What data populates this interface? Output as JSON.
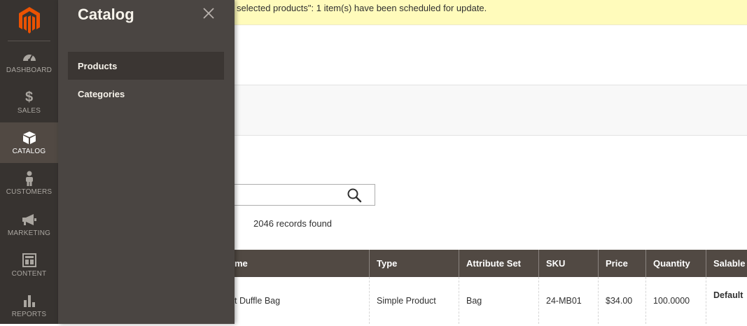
{
  "notice": {
    "text": "selected products\": 1 item(s) have been scheduled for update."
  },
  "nav": {
    "items": [
      {
        "label": "DASHBOARD",
        "icon": "dashboard-icon"
      },
      {
        "label": "SALES",
        "icon": "dollar-icon"
      },
      {
        "label": "CATALOG",
        "icon": "box-icon",
        "active": true
      },
      {
        "label": "CUSTOMERS",
        "icon": "person-icon"
      },
      {
        "label": "MARKETING",
        "icon": "megaphone-icon"
      },
      {
        "label": "CONTENT",
        "icon": "layout-icon"
      },
      {
        "label": "REPORTS",
        "icon": "bar-chart-icon"
      }
    ]
  },
  "submenu": {
    "title": "Catalog",
    "items": [
      {
        "label": "Products",
        "active": true
      },
      {
        "label": "Categories"
      }
    ]
  },
  "grid": {
    "records_found": "2046 records found",
    "columns": [
      "me",
      "Type",
      "Attribute Set",
      "SKU",
      "Price",
      "Quantity",
      "Salable Q"
    ],
    "rows": [
      {
        "name": "t Duffle Bag",
        "type": "Simple Product",
        "attribute_set": "Bag",
        "sku": "24-MB01",
        "price": "$34.00",
        "quantity": "100.0000",
        "salable": "Default"
      }
    ]
  },
  "colors": {
    "nav_bg": "#373330",
    "submenu_bg": "#4a4542",
    "header_bg": "#514943",
    "brand_orange": "#eb5202",
    "notice_bg": "#fffbbb"
  }
}
